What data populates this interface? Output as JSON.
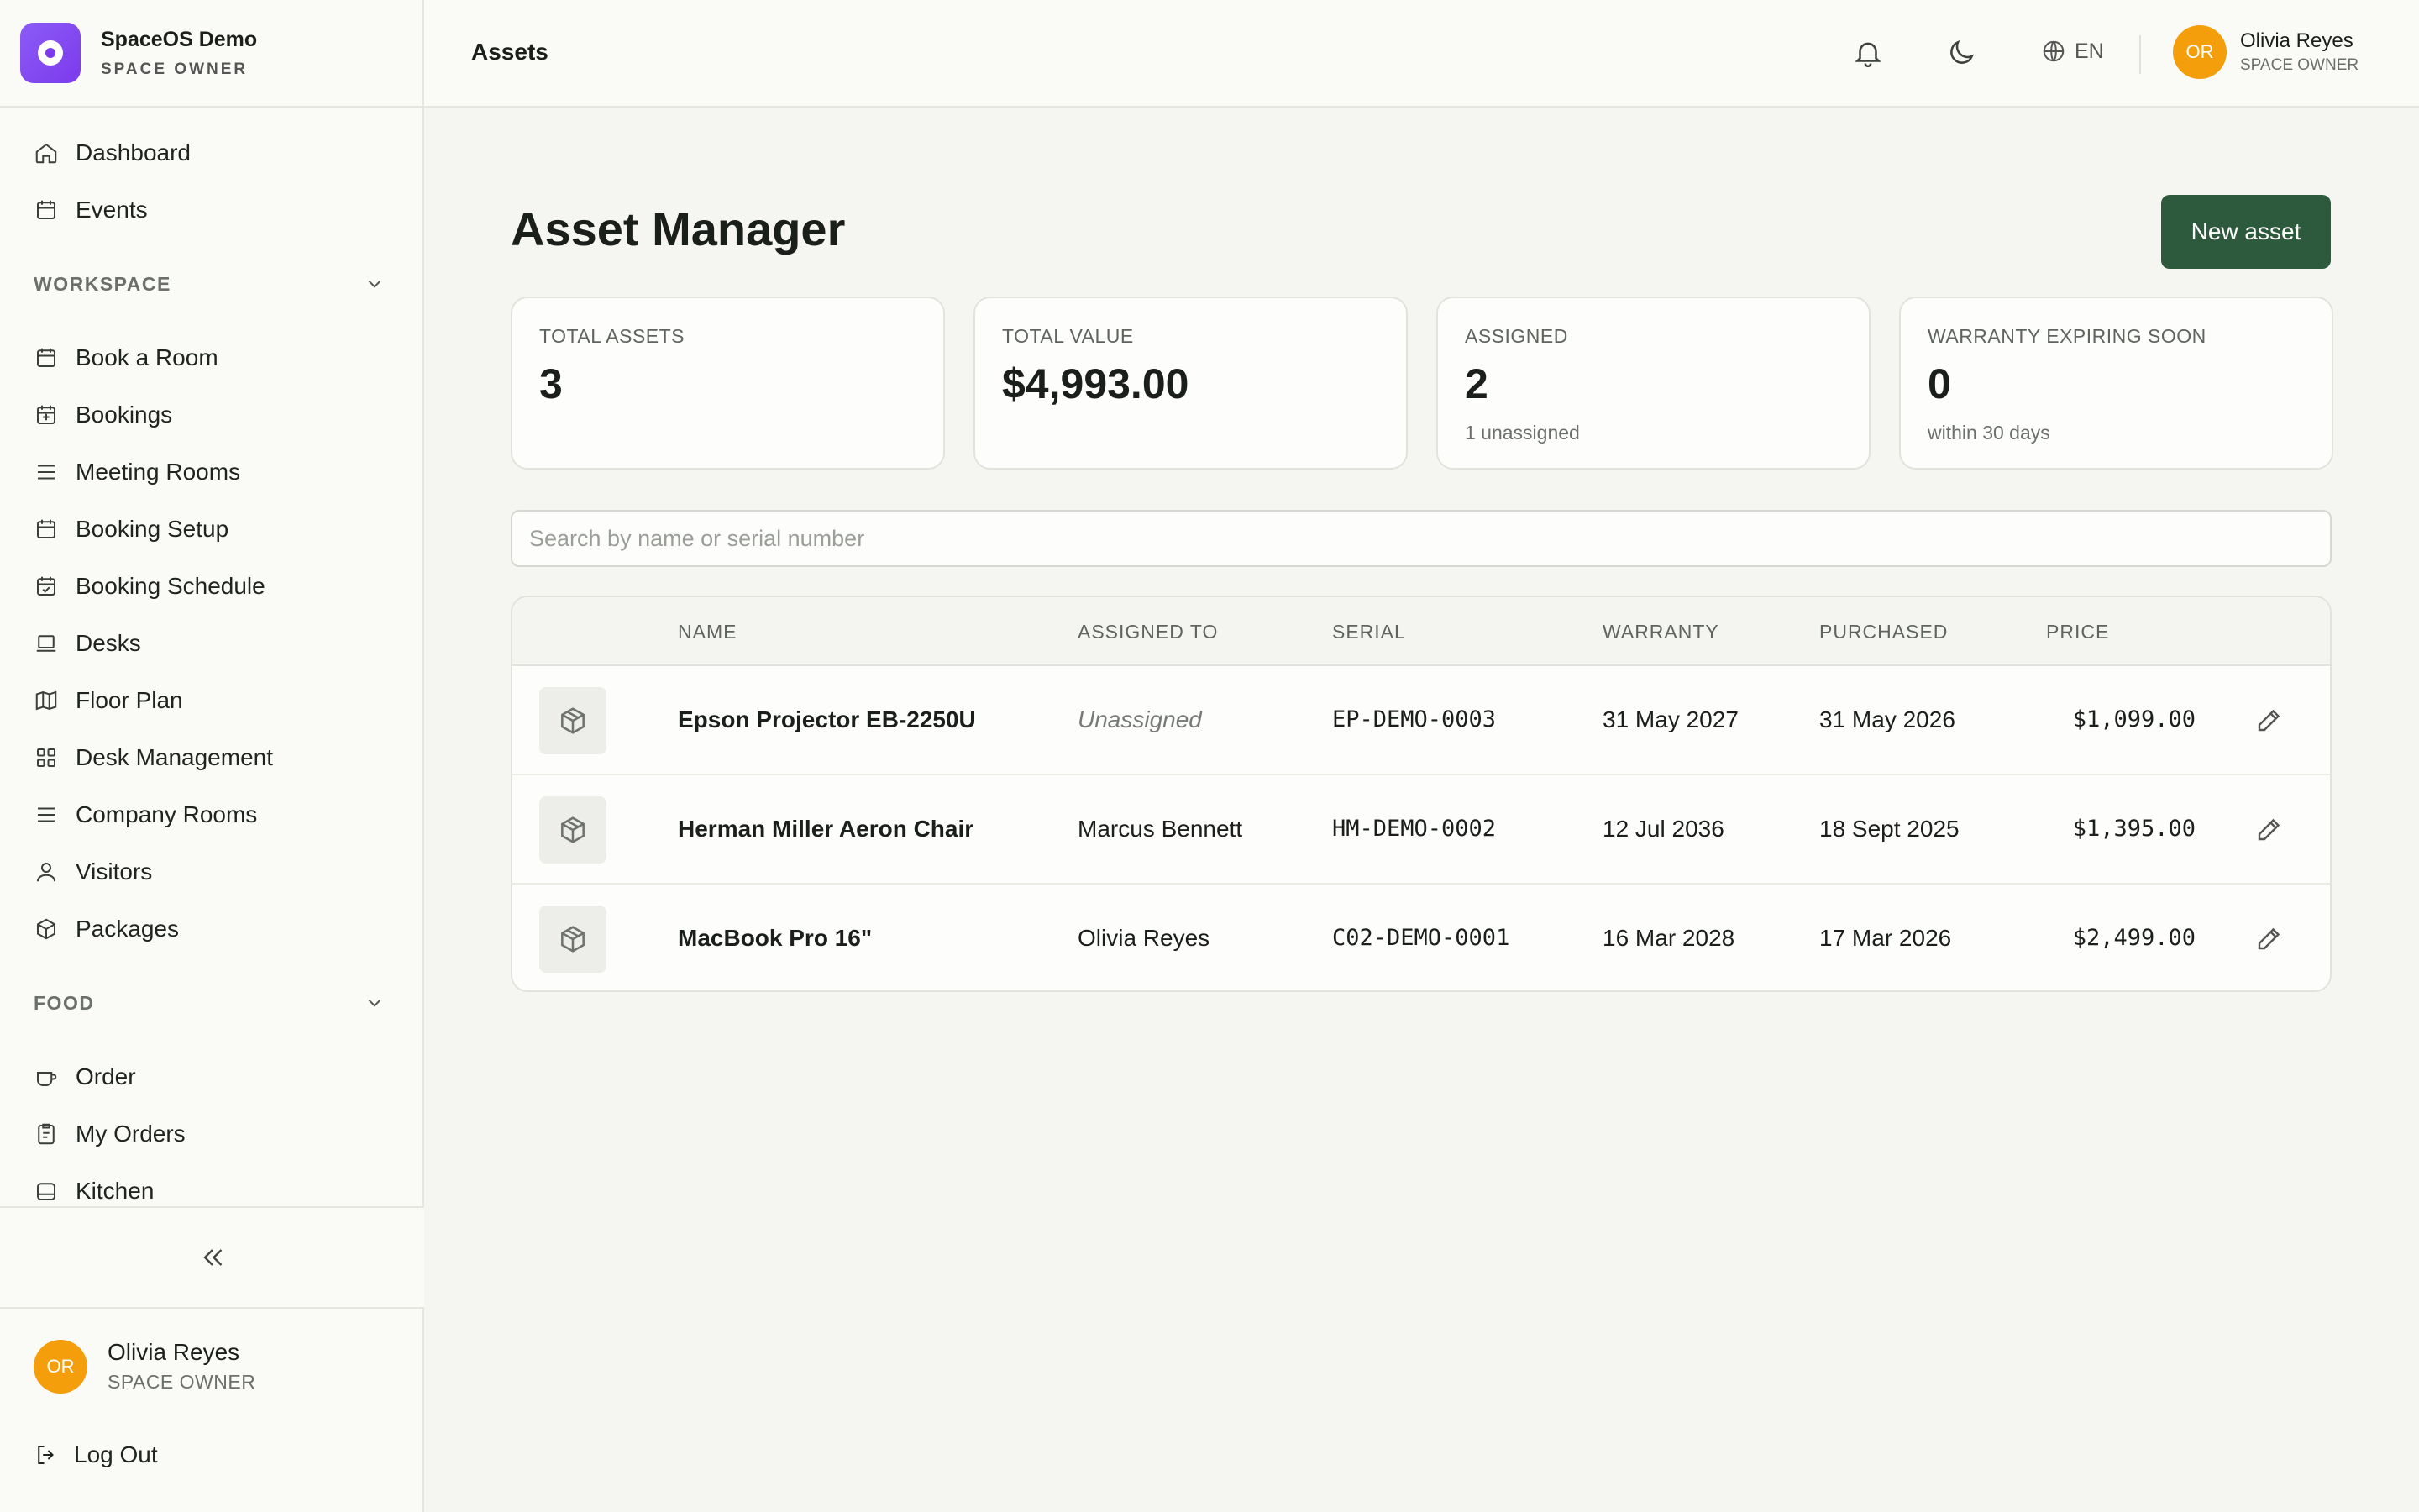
{
  "brand": {
    "name": "SpaceOS Demo",
    "role": "SPACE OWNER",
    "accent": "#7c3aed"
  },
  "nav": {
    "top_items": [
      {
        "label": "Dashboard",
        "icon": "home-icon"
      },
      {
        "label": "Events",
        "icon": "calendar-icon"
      }
    ],
    "workspace": {
      "heading": "WORKSPACE",
      "items": [
        {
          "label": "Book a Room",
          "icon": "calendar-icon"
        },
        {
          "label": "Bookings",
          "icon": "calendar-list-icon"
        },
        {
          "label": "Meeting Rooms",
          "icon": "lines-icon"
        },
        {
          "label": "Booking Setup",
          "icon": "calendar-icon"
        },
        {
          "label": "Booking Schedule",
          "icon": "calendar-check-icon"
        },
        {
          "label": "Desks",
          "icon": "laptop-icon"
        },
        {
          "label": "Floor Plan",
          "icon": "map-icon"
        },
        {
          "label": "Desk Management",
          "icon": "grid-icon"
        },
        {
          "label": "Company Rooms",
          "icon": "lines-icon"
        },
        {
          "label": "Visitors",
          "icon": "user-icon"
        },
        {
          "label": "Packages",
          "icon": "package-icon"
        }
      ]
    },
    "food": {
      "heading": "FOOD",
      "items": [
        {
          "label": "Order",
          "icon": "cup-icon"
        },
        {
          "label": "My Orders",
          "icon": "clipboard-icon"
        },
        {
          "label": "Kitchen",
          "icon": "kitchen-icon"
        }
      ]
    }
  },
  "sidebar_user": {
    "initials": "OR",
    "name": "Olivia Reyes",
    "role": "SPACE OWNER",
    "avatar_color": "#f59e0b"
  },
  "logout_label": "Log Out",
  "topbar": {
    "title": "Assets",
    "language": "EN",
    "user": {
      "initials": "OR",
      "name": "Olivia Reyes",
      "role": "SPACE OWNER"
    }
  },
  "page": {
    "title": "Asset Manager",
    "new_button": "New asset",
    "primary_color": "#2d5a3d"
  },
  "stats": [
    {
      "label": "TOTAL ASSETS",
      "value": "3",
      "sub": ""
    },
    {
      "label": "TOTAL VALUE",
      "value": "$4,993.00",
      "sub": ""
    },
    {
      "label": "ASSIGNED",
      "value": "2",
      "sub": "1 unassigned"
    },
    {
      "label": "WARRANTY EXPIRING SOON",
      "value": "0",
      "sub": "within 30 days"
    }
  ],
  "search": {
    "placeholder": "Search by name or serial number",
    "value": ""
  },
  "table": {
    "headers": {
      "name": "NAME",
      "assigned": "ASSIGNED TO",
      "serial": "SERIAL",
      "warranty": "WARRANTY",
      "purchased": "PURCHASED",
      "price": "PRICE"
    },
    "rows": [
      {
        "name": "Epson Projector EB-2250U",
        "assigned": "Unassigned",
        "serial": "EP-DEMO-0003",
        "warranty": "31 May 2027",
        "purchased": "31 May 2026",
        "price": "$1,099.00"
      },
      {
        "name": "Herman Miller Aeron Chair",
        "assigned": "Marcus Bennett",
        "serial": "HM-DEMO-0002",
        "warranty": "12 Jul 2036",
        "purchased": "18 Sept 2025",
        "price": "$1,395.00"
      },
      {
        "name": "MacBook Pro 16\"",
        "assigned": "Olivia Reyes",
        "serial": "C02-DEMO-0001",
        "warranty": "16 Mar 2028",
        "purchased": "17 Mar 2026",
        "price": "$2,499.00"
      }
    ]
  }
}
